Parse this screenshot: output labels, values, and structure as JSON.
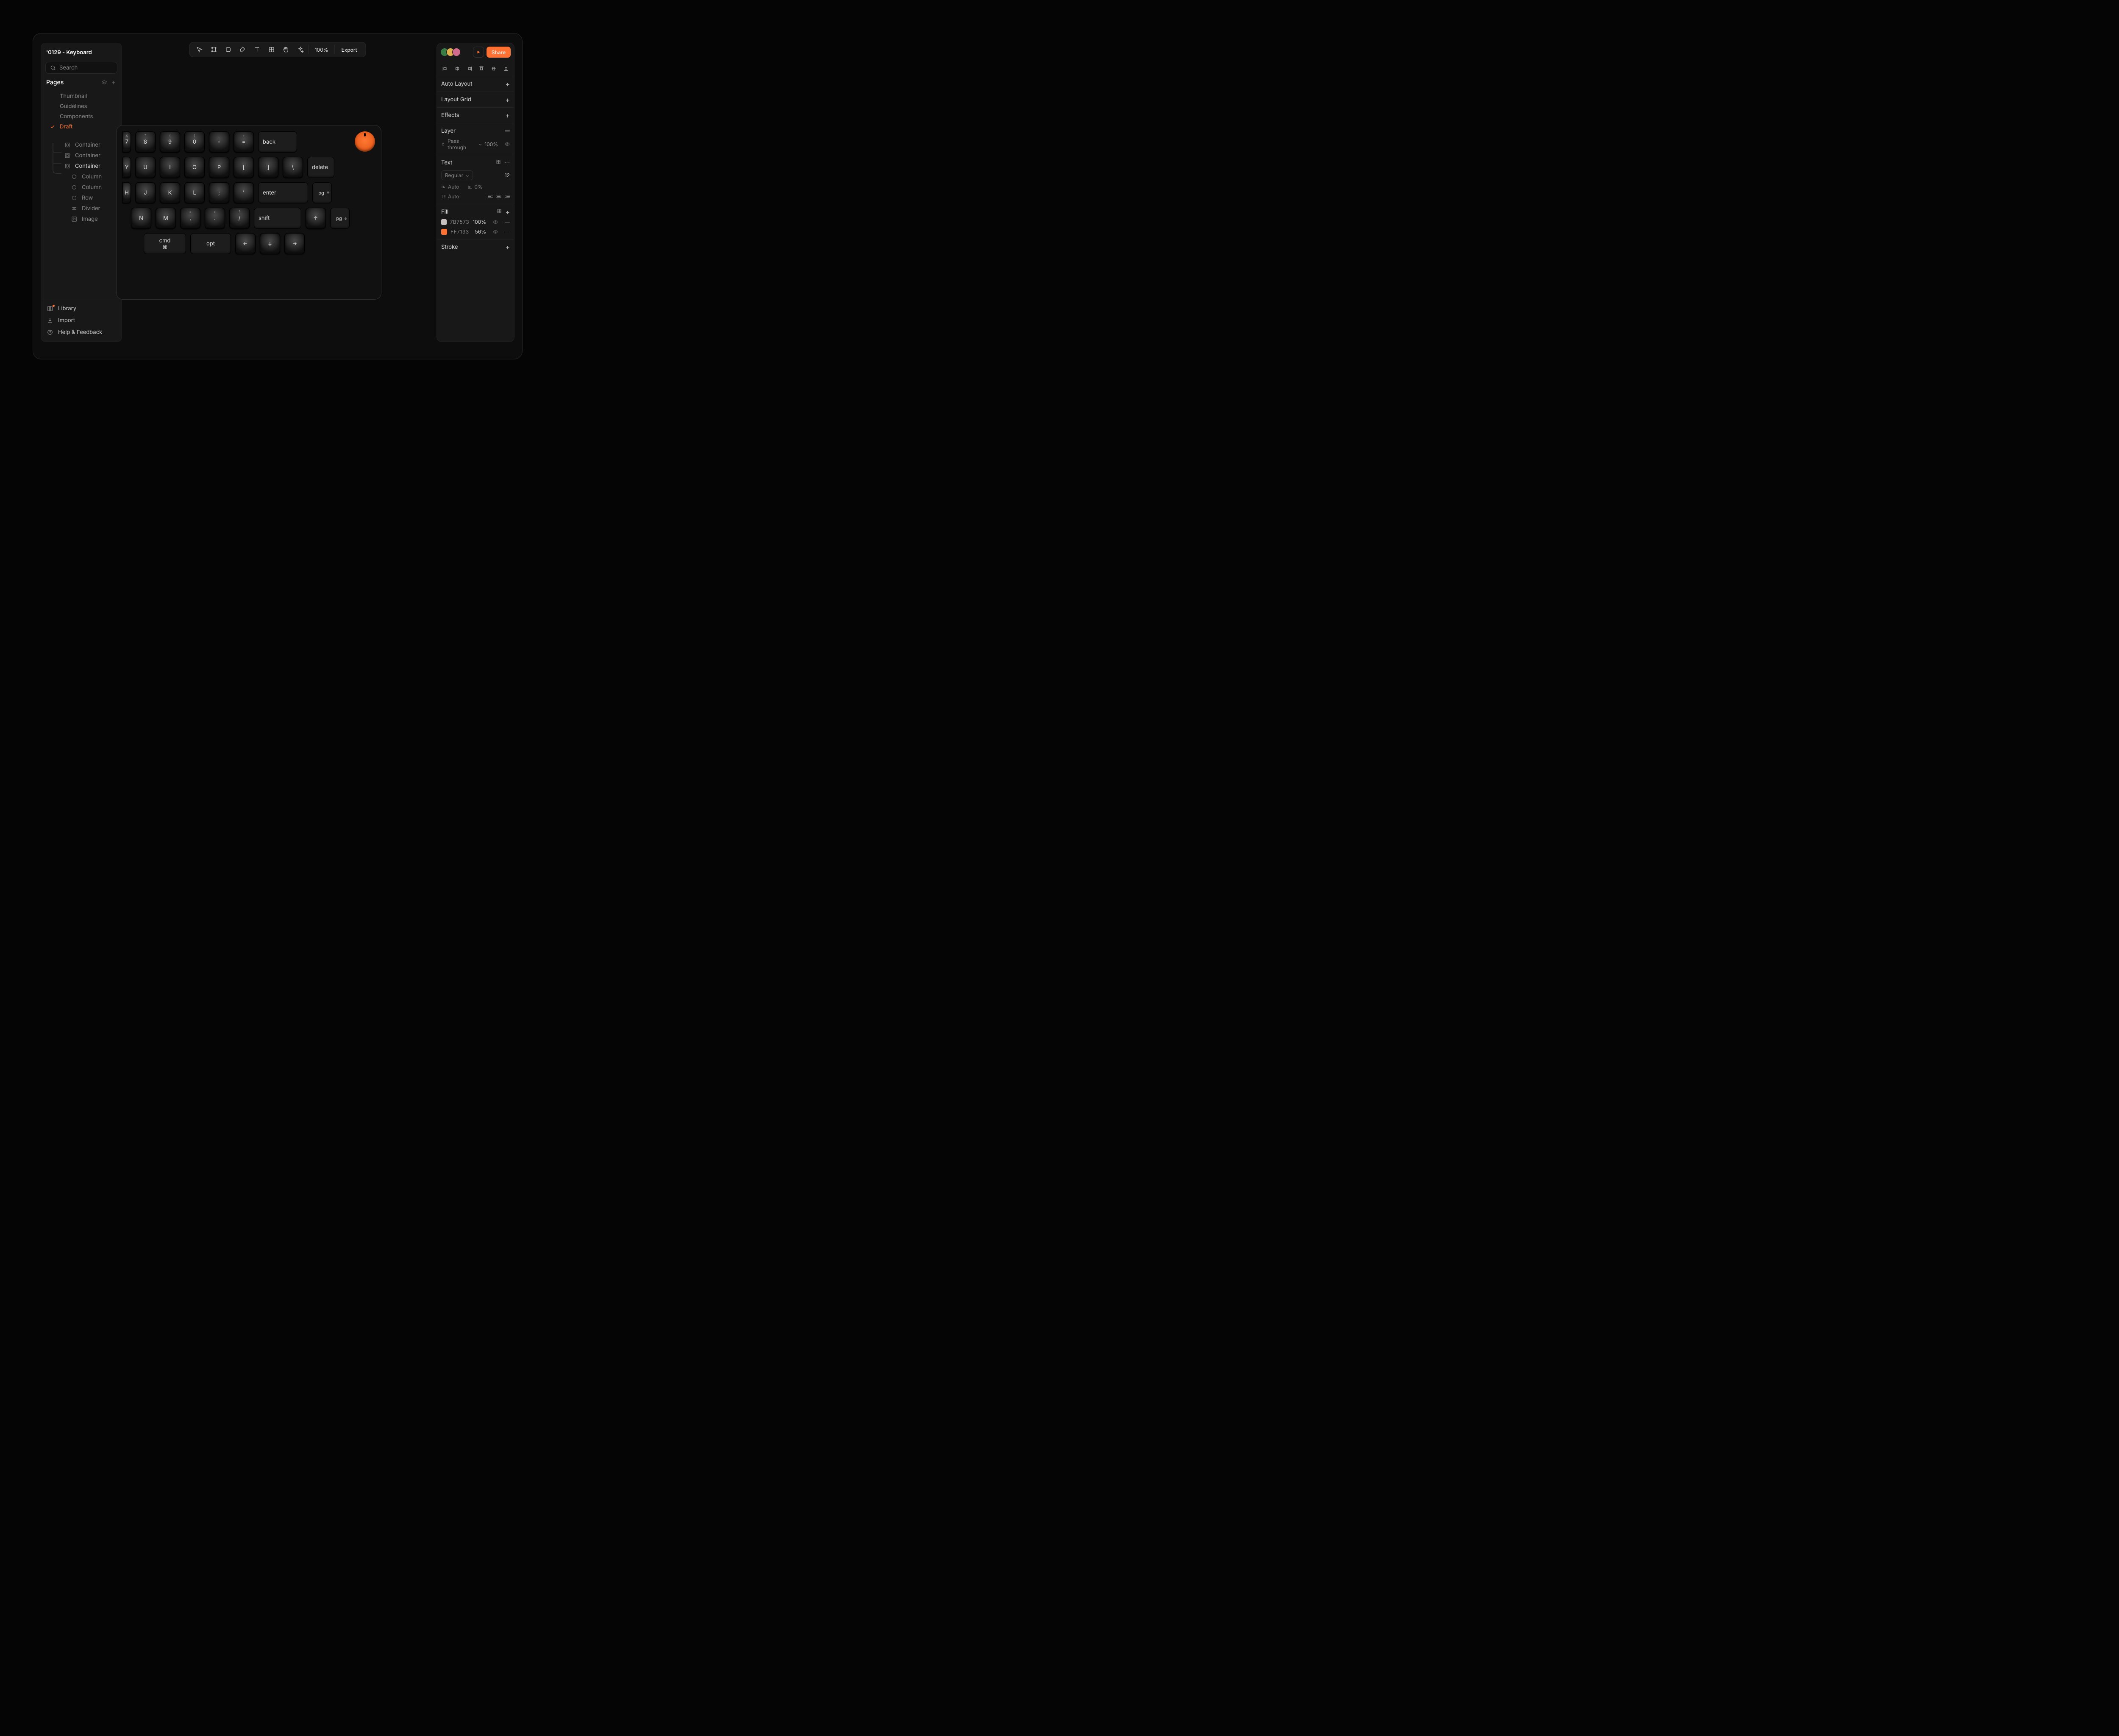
{
  "title": "'0129 - Keyboard",
  "search_placeholder": "Search",
  "sections": {
    "pages": "Pages"
  },
  "pages": [
    {
      "label": "Thumbnail"
    },
    {
      "label": "Guidelines"
    },
    {
      "label": "Components"
    },
    {
      "label": "Draft",
      "active": true
    }
  ],
  "tree": {
    "containers": [
      {
        "label": "Container"
      },
      {
        "label": "Container"
      },
      {
        "label": "Container",
        "last": true
      }
    ],
    "leaves": [
      {
        "icon": "circle",
        "label": "Column"
      },
      {
        "icon": "circle",
        "label": "Column"
      },
      {
        "icon": "circle",
        "label": "Row"
      },
      {
        "icon": "divider",
        "label": "Divider"
      },
      {
        "icon": "image",
        "label": "Image"
      }
    ]
  },
  "footer": [
    {
      "key": "library",
      "label": "Library"
    },
    {
      "key": "import",
      "label": "Import"
    },
    {
      "key": "help",
      "label": "Help & Feedback"
    }
  ],
  "toolbar": {
    "zoom": "100%",
    "export": "Export"
  },
  "right": {
    "share": "Share",
    "auto_layout": "Auto Layout",
    "layout_grid": "Layout Grid",
    "effects": "Effects",
    "layer": "Layer",
    "layer_mode": "Pass through",
    "layer_opacity": "100%",
    "text": "Text",
    "text_weight": "Regular",
    "text_size": "12",
    "text_auto1": "Auto",
    "text_pct": "0%",
    "text_auto2": "Auto",
    "fill": "Fill",
    "fills": [
      {
        "hex": "7B7573",
        "pct": "100%",
        "color": "#c7c1bf"
      },
      {
        "hex": "FF7133",
        "pct": "56%",
        "color": "#ff7133"
      }
    ],
    "stroke": "Stroke"
  },
  "avatars": [
    "#3a7d44",
    "#e0b050",
    "#d06b8e"
  ],
  "keyboard": {
    "row1": [
      {
        "upper": "&",
        "label": "7"
      },
      {
        "upper": "*",
        "label": "8"
      },
      {
        "upper": "(",
        "label": "9"
      },
      {
        "upper": ")",
        "label": "0"
      },
      {
        "upper": "_",
        "label": "-"
      },
      {
        "upper": "+",
        "label": "="
      }
    ],
    "back": "back",
    "row2_start": "Y",
    "row2": [
      "U",
      "I",
      "O",
      "P",
      "[",
      "]",
      "\\"
    ],
    "delete": "delete",
    "row3_start": "H",
    "row3": [
      "J",
      "K",
      "L",
      ";",
      "'"
    ],
    "enter": "enter",
    "pg": "pg",
    "row4": [
      "N",
      "M",
      ",",
      ".",
      "/"
    ],
    "row4_upper": [
      "",
      "",
      "<",
      ">",
      "?"
    ],
    "shift": "shift",
    "cmd": "cmd",
    "opt": "opt"
  }
}
